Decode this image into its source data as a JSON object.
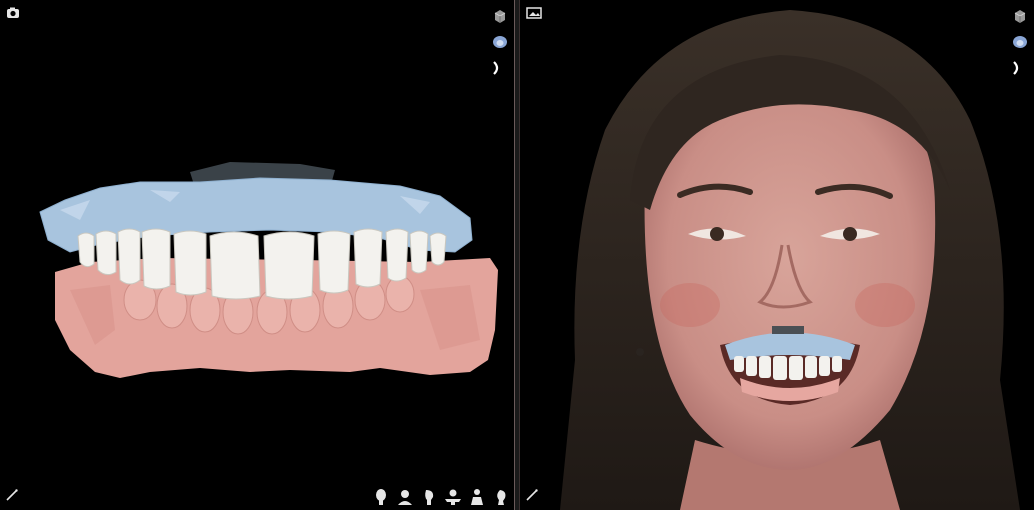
{
  "colors": {
    "background": "#000000",
    "divider": "#5a4a4a",
    "upper_model": "#a9c3dd",
    "lower_model": "#e6a7a0",
    "teeth": "#f2f1ec",
    "icon": "#e6e6e6",
    "active_icon": "#8aa6d6"
  },
  "icons": {
    "left_top": "camera-icon",
    "right_top": "image-icon",
    "cube": "cube-icon",
    "arch": "dental-arch-icon",
    "curve": "bracket-icon",
    "wand": "wand-icon",
    "views": [
      "view-front-icon",
      "view-face-icon",
      "view-side-icon",
      "view-bust-icon",
      "view-body-icon",
      "view-profile-icon"
    ]
  }
}
